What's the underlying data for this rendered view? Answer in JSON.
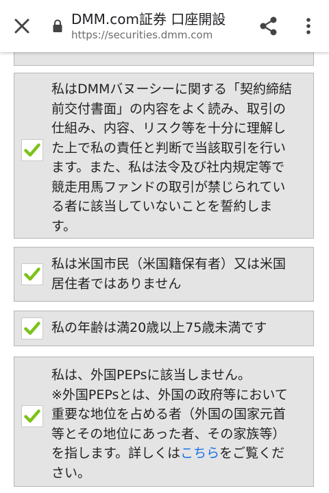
{
  "header": {
    "title": "DMM.com証券 口座開設",
    "url": "https://securities.dmm.com",
    "icons": {
      "close": "close-icon",
      "lock": "lock-icon",
      "share": "share-icon",
      "menu": "more-vert-icon"
    }
  },
  "colors": {
    "check": "#7cc21a",
    "box_bg": "#e4e4e4",
    "link": "#1a73e8"
  },
  "confirmations": [
    {
      "checked": true,
      "lines": [
        "私はDMMバヌーシーに関する「契約締結",
        "前交付書面」の内容をよく読み、取引の",
        "仕組み、内容、リスク等を十分に理解し",
        "た上で私の責任と判断で当該取引を行い",
        "ます。また、私は法令及び社内規定等で",
        "競走用馬ファンドの取引が禁じられてい",
        "る者に該当していないことを誓約しま",
        "す。"
      ]
    },
    {
      "checked": true,
      "lines": [
        "私は米国市民（米国籍保有者）又は米国",
        "居住者ではありません"
      ]
    },
    {
      "checked": true,
      "lines": [
        "私の年齢は満20歳以上75歳未満です"
      ]
    },
    {
      "checked": true,
      "lines": [
        "私は、外国PEPsに該当しません。",
        "※外国PEPsとは、外国の政府等において",
        "重要な地位を占める者（外国の国家元首",
        "等とその地位にあった者、その家族等）"
      ],
      "line5_prefix": "を指します。詳しくは",
      "line5_link": "こちら",
      "line5_suffix": "をご覧くだ",
      "line6": "さい。"
    }
  ]
}
